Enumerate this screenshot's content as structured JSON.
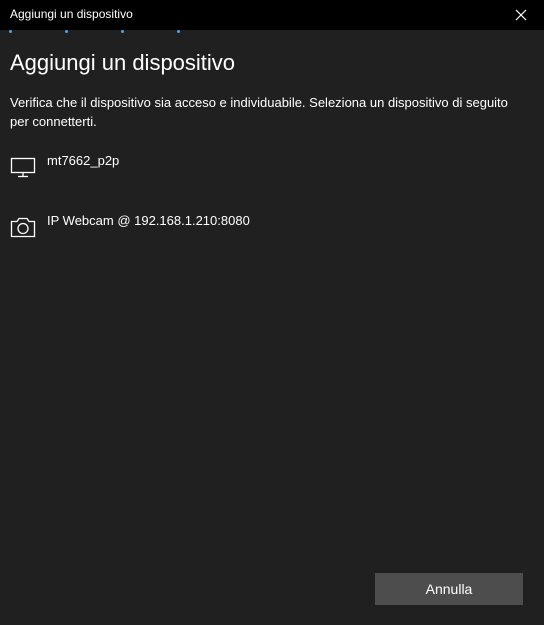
{
  "window": {
    "title": "Aggiungi un dispositivo"
  },
  "main": {
    "heading": "Aggiungi un dispositivo",
    "description": "Verifica che il dispositivo sia acceso e individuabile. Seleziona un dispositivo di seguito per connetterti."
  },
  "devices": [
    {
      "name": "mt7662_p2p",
      "icon": "monitor-icon"
    },
    {
      "name": "IP Webcam @ 192.168.1.210:8080",
      "icon": "camera-icon"
    }
  ],
  "footer": {
    "cancel_label": "Annulla"
  },
  "colors": {
    "background": "#202020",
    "titlebar": "#000000",
    "accent": "#4aa3f0",
    "button": "#4d4d4d",
    "text": "#ffffff"
  }
}
